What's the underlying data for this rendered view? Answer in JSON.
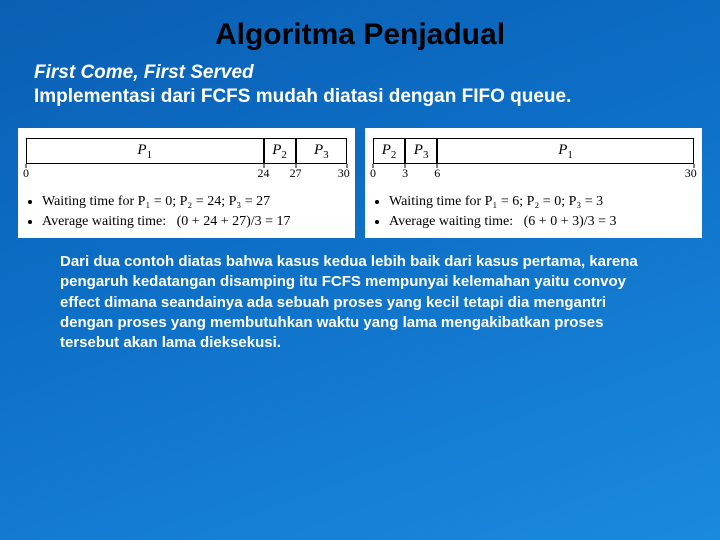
{
  "title": "Algoritma Penjadual",
  "subtitle": "First Come, First Served",
  "desc": "Implementasi dari FCFS mudah diatasi dengan FIFO queue.",
  "proc": {
    "p1": "P",
    "p2": "P",
    "p3": "P",
    "s1": "1",
    "s2": "2",
    "s3": "3"
  },
  "left": {
    "ticks": {
      "t0": "0",
      "t1": "24",
      "t2": "27",
      "t3": "30"
    },
    "b1": "Waiting time for P₁ = 0; P₂ = 24; P₃ = 27",
    "b2_a": "Average waiting time:",
    "b2_b": "(0 + 24 + 27)/3 = 17"
  },
  "right": {
    "ticks": {
      "t0": "0",
      "t1": "3",
      "t2": "6",
      "t3": "30"
    },
    "b1": "Waiting time for P₁ = 6; P₂ = 0; P₃ = 3",
    "b2_a": "Average waiting time:",
    "b2_b": "(6 + 0 + 3)/3 = 3"
  },
  "conclusion": "Dari dua contoh diatas bahwa kasus kedua lebih baik dari kasus pertama, karena pengaruh kedatangan disamping itu FCFS mempunyai kelemahan yaitu convoy effect dimana seandainya ada sebuah proses yang kecil tetapi dia mengantri dengan proses yang membutuhkan waktu yang lama mengakibatkan proses tersebut akan lama dieksekusi.",
  "chart_data": [
    {
      "type": "bar",
      "title": "Gantt FCFS case 1",
      "categories": [
        "P1",
        "P2",
        "P3"
      ],
      "start": [
        0,
        24,
        27
      ],
      "end": [
        24,
        27,
        30
      ],
      "xlim": [
        0,
        30
      ],
      "waiting_times": {
        "P1": 0,
        "P2": 24,
        "P3": 27
      },
      "avg_wait": 17
    },
    {
      "type": "bar",
      "title": "Gantt FCFS case 2",
      "categories": [
        "P2",
        "P3",
        "P1"
      ],
      "start": [
        0,
        3,
        6
      ],
      "end": [
        3,
        6,
        30
      ],
      "xlim": [
        0,
        30
      ],
      "waiting_times": {
        "P1": 6,
        "P2": 0,
        "P3": 3
      },
      "avg_wait": 3
    }
  ]
}
